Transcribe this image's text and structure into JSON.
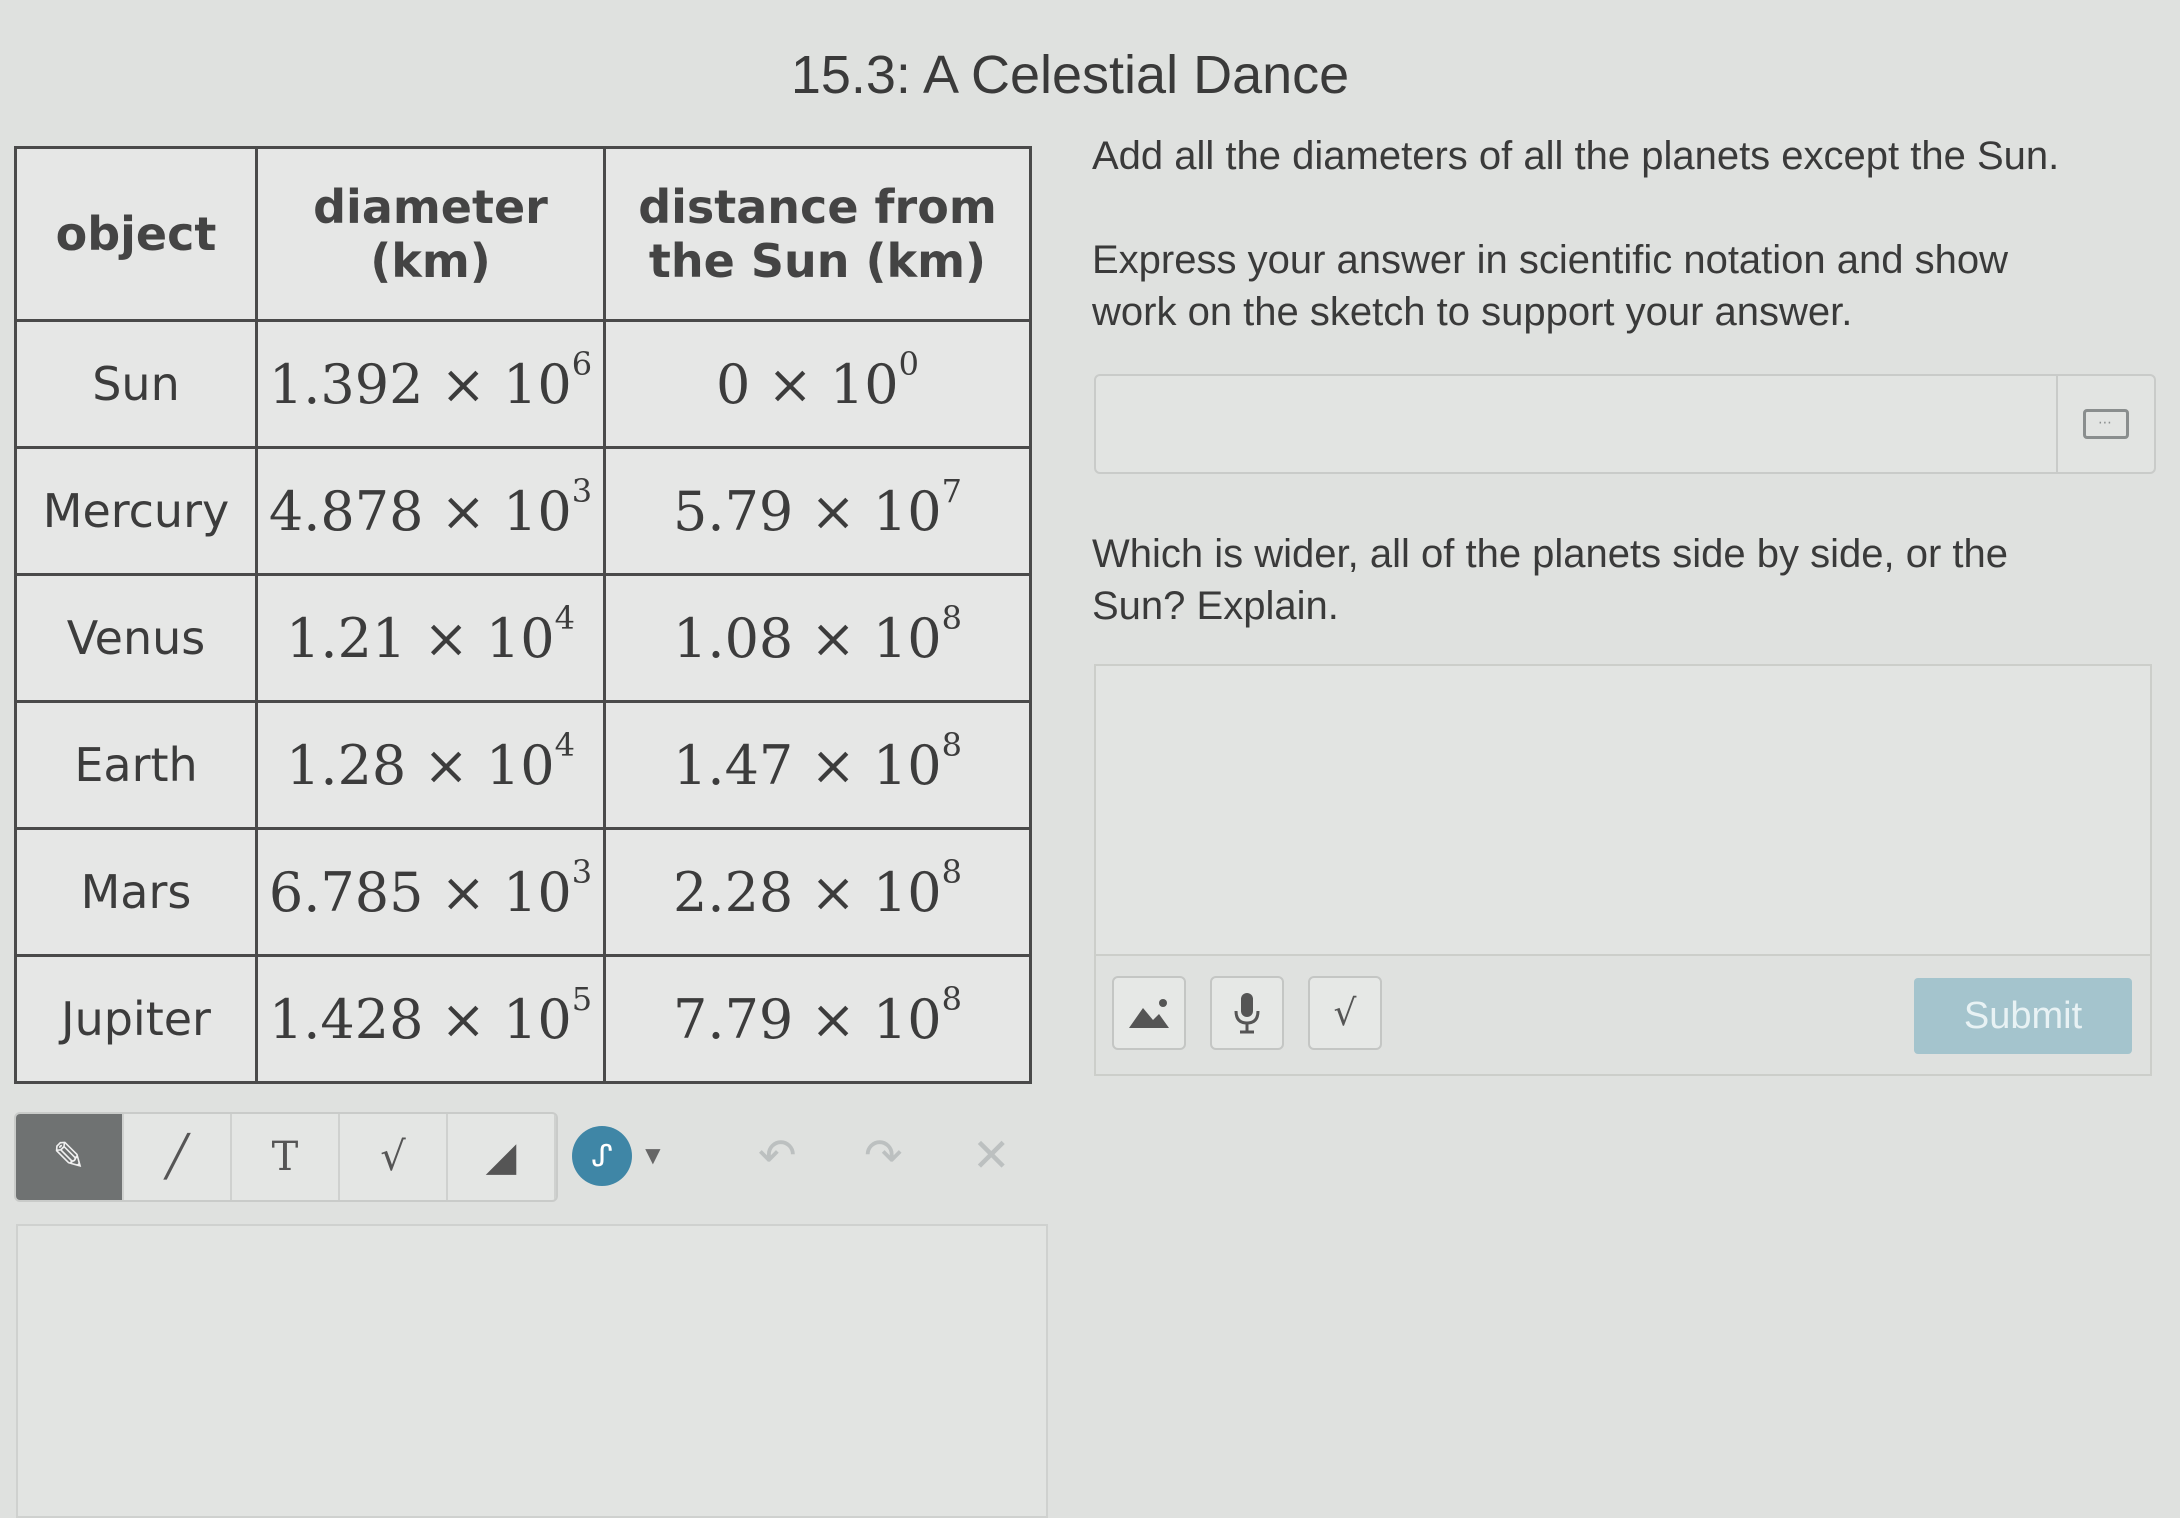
{
  "page": {
    "title": "15.3: A Celestial Dance"
  },
  "table": {
    "headers": [
      "object",
      "diameter\n(km)",
      "distance from\nthe Sun (km)"
    ],
    "rows": [
      {
        "object": "Sun",
        "diameter": {
          "coef": "1.392",
          "exp": "6"
        },
        "distance": {
          "coef": "0",
          "exp": "0"
        }
      },
      {
        "object": "Mercury",
        "diameter": {
          "coef": "4.878",
          "exp": "3"
        },
        "distance": {
          "coef": "5.79",
          "exp": "7"
        }
      },
      {
        "object": "Venus",
        "diameter": {
          "coef": "1.21",
          "exp": "4"
        },
        "distance": {
          "coef": "1.08",
          "exp": "8"
        }
      },
      {
        "object": "Earth",
        "diameter": {
          "coef": "1.28",
          "exp": "4"
        },
        "distance": {
          "coef": "1.47",
          "exp": "8"
        }
      },
      {
        "object": "Mars",
        "diameter": {
          "coef": "6.785",
          "exp": "3"
        },
        "distance": {
          "coef": "2.28",
          "exp": "8"
        }
      },
      {
        "object": "Jupiter",
        "diameter": {
          "coef": "1.428",
          "exp": "5"
        },
        "distance": {
          "coef": "7.79",
          "exp": "8"
        }
      }
    ],
    "times_sign": " × 10"
  },
  "questions": {
    "q1": "Add all the diameters of all the planets except the Sun.",
    "q2": "Express your answer in scientific notation and show work on the sketch to support your answer.",
    "q3": "Which is wider, all of the planets side by side, or the Sun? Explain.",
    "answer_value": "",
    "response_value": ""
  },
  "response_toolbar": {
    "image_icon": "image-icon",
    "mic_icon": "microphone-icon",
    "math_icon": "square-root-icon",
    "math_glyph": "√",
    "submit_label": "Submit"
  },
  "sketch_toolbar": {
    "tools": [
      {
        "name": "pencil-icon",
        "glyph": "✎",
        "active": true
      },
      {
        "name": "line-icon",
        "glyph": "╱",
        "active": false
      },
      {
        "name": "text-tool-icon",
        "glyph": "T",
        "active": false
      },
      {
        "name": "math-tool-icon",
        "glyph": "√",
        "active": false
      },
      {
        "name": "eraser-icon",
        "glyph": "◢",
        "active": false
      }
    ],
    "color_glyph": "ᔑ",
    "undo_glyph": "↶",
    "redo_glyph": "↷",
    "clear_glyph": "✕"
  },
  "colors": {
    "accent": "#3f86a6",
    "submit": "#a4c4cd",
    "active_tool": "#6f7272"
  }
}
